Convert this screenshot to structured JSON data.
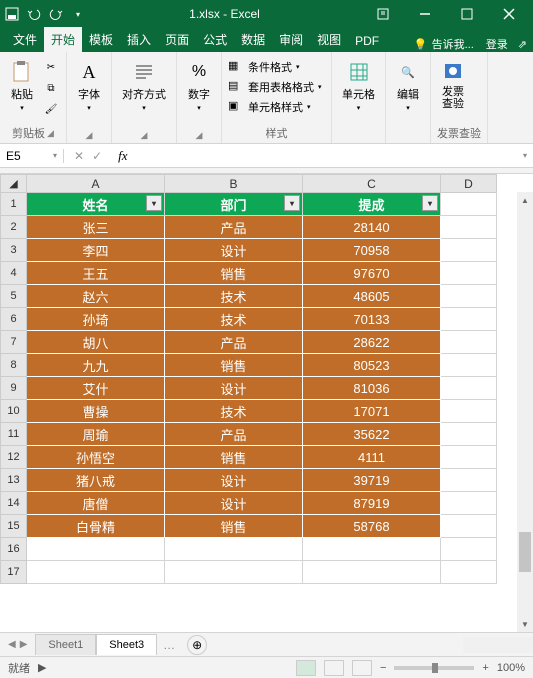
{
  "titlebar": {
    "title": "1.xlsx - Excel"
  },
  "tabs": {
    "file": "文件",
    "home": "开始",
    "tpl": "模板",
    "insert": "插入",
    "page": "页面",
    "formula": "公式",
    "data": "数据",
    "review": "审阅",
    "view": "视图",
    "pdf": "PDF",
    "tell": "告诉我...",
    "login": "登录"
  },
  "ribbon": {
    "clipboard": {
      "paste": "粘贴",
      "label": "剪贴板"
    },
    "font": {
      "label": "字体"
    },
    "align": {
      "label": "对齐方式"
    },
    "number": {
      "label": "数字"
    },
    "style": {
      "cond": "条件格式",
      "tbl": "套用表格格式",
      "cell": "单元格样式",
      "label": "样式"
    },
    "cells": {
      "label": "单元格"
    },
    "edit": {
      "label": "编辑"
    },
    "invoice": {
      "btn": "发票\n查验",
      "label": "发票查验"
    }
  },
  "fbar": {
    "name": "E5"
  },
  "headers": [
    "姓名",
    "部门",
    "提成"
  ],
  "rows": [
    {
      "name": "张三",
      "dept": "产品",
      "val": 28140
    },
    {
      "name": "李四",
      "dept": "设计",
      "val": 70958
    },
    {
      "name": "王五",
      "dept": "销售",
      "val": 97670
    },
    {
      "name": "赵六",
      "dept": "技术",
      "val": 48605
    },
    {
      "name": "孙琦",
      "dept": "技术",
      "val": 70133
    },
    {
      "name": "胡八",
      "dept": "产品",
      "val": 28622
    },
    {
      "name": "九九",
      "dept": "销售",
      "val": 80523
    },
    {
      "name": "艾什",
      "dept": "设计",
      "val": 81036
    },
    {
      "name": "曹操",
      "dept": "技术",
      "val": 17071
    },
    {
      "name": "周瑜",
      "dept": "产品",
      "val": 35622
    },
    {
      "name": "孙悟空",
      "dept": "销售",
      "val": 4111
    },
    {
      "name": "猪八戒",
      "dept": "设计",
      "val": 39719
    },
    {
      "name": "唐僧",
      "dept": "设计",
      "val": 87919
    },
    {
      "name": "白骨精",
      "dept": "销售",
      "val": 58768
    }
  ],
  "sheets": {
    "s1": "Sheet1",
    "s3": "Sheet3"
  },
  "status": {
    "ready": "就绪",
    "zoom": "100%"
  },
  "cols": [
    "A",
    "B",
    "C",
    "D"
  ]
}
